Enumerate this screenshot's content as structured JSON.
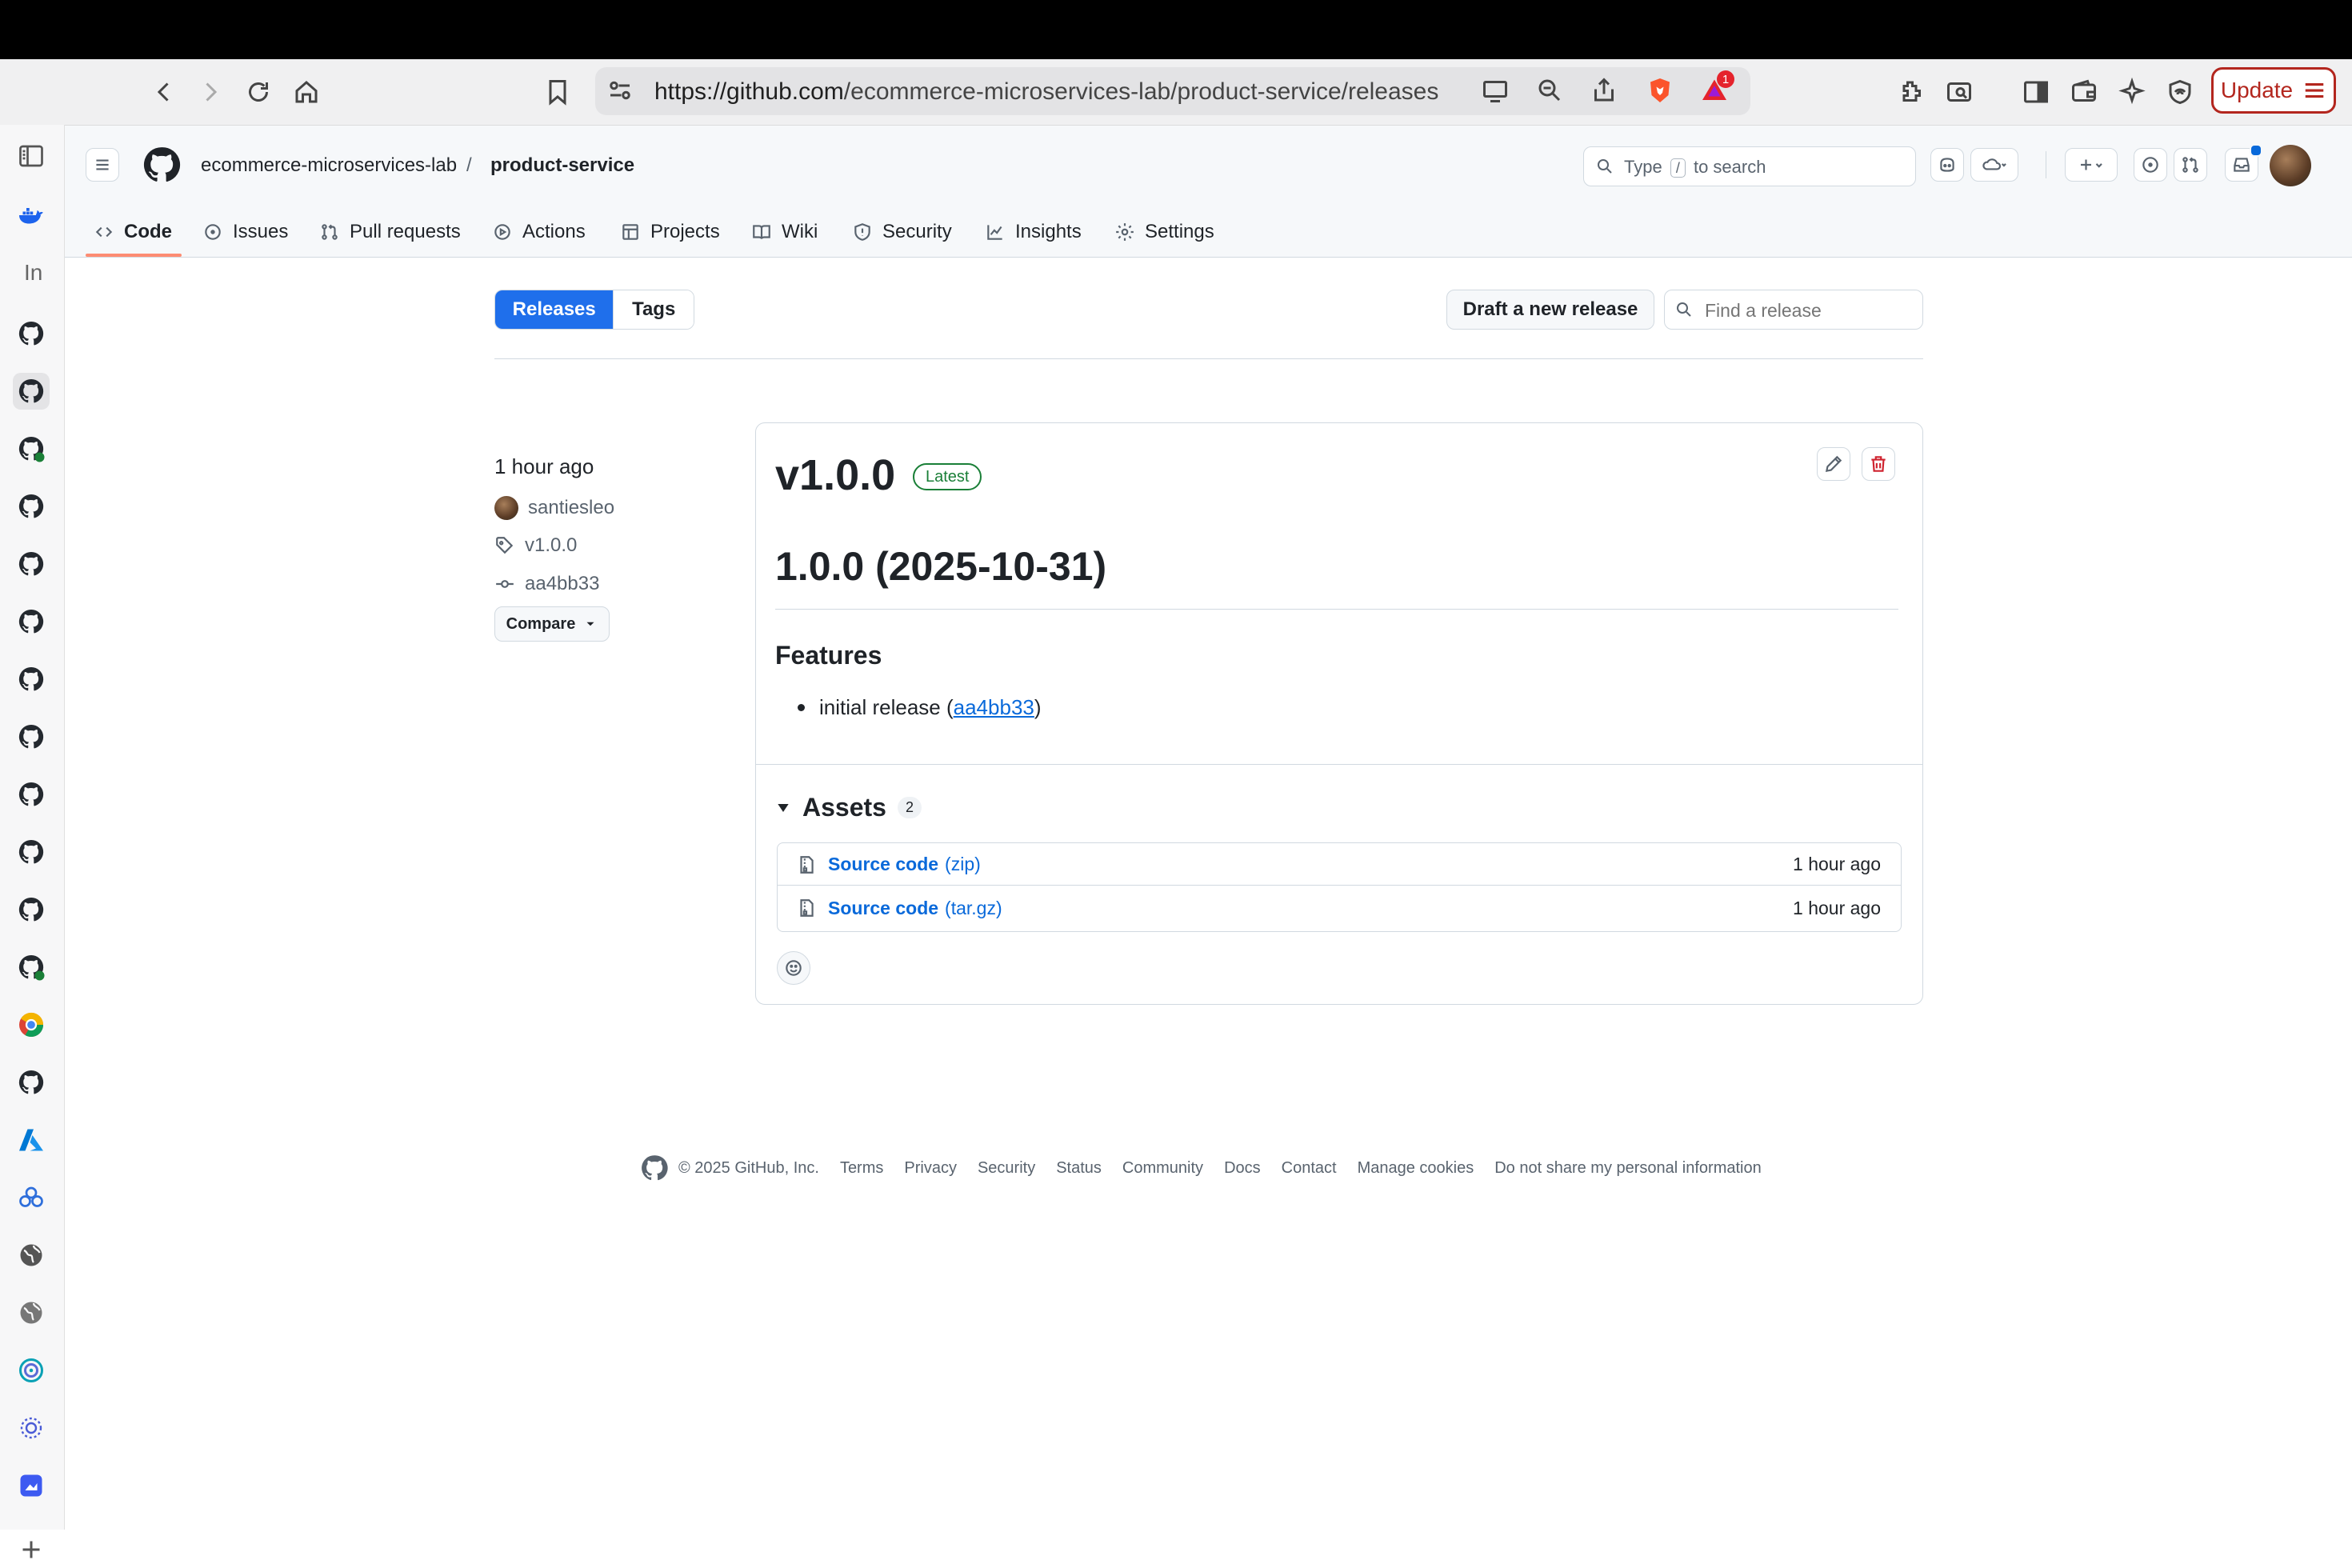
{
  "browser": {
    "url_host": "https://github.com",
    "url_path": "/ecommerce-microservices-lab/product-service/releases",
    "notification_badge": "1",
    "update_label": "Update"
  },
  "sidebar": {
    "partial_label": "In"
  },
  "header": {
    "owner": "ecommerce-microservices-lab",
    "separator": "/",
    "repo": "product-service",
    "search_prefix": "Type",
    "search_key": "/",
    "search_suffix": "to search"
  },
  "repo_tabs": [
    {
      "label": "Code"
    },
    {
      "label": "Issues"
    },
    {
      "label": "Pull requests"
    },
    {
      "label": "Actions"
    },
    {
      "label": "Projects"
    },
    {
      "label": "Wiki"
    },
    {
      "label": "Security"
    },
    {
      "label": "Insights"
    },
    {
      "label": "Settings"
    }
  ],
  "releases_nav": {
    "releases_label": "Releases",
    "tags_label": "Tags",
    "draft_label": "Draft a new release",
    "find_placeholder": "Find a release"
  },
  "release": {
    "time_ago": "1 hour ago",
    "author": "santiesleo",
    "tag": "v1.0.0",
    "commit": "aa4bb33",
    "compare_label": "Compare",
    "title": "v1.0.0",
    "latest_badge": "Latest",
    "notes_heading": "1.0.0 (2025-10-31)",
    "section_heading": "Features",
    "bullet_text": "initial release (",
    "bullet_link": "aa4bb33",
    "bullet_close": ")",
    "assets_label": "Assets",
    "assets_count": "2",
    "assets": [
      {
        "name": "Source code",
        "ext": "(zip)",
        "time": "1 hour ago"
      },
      {
        "name": "Source code",
        "ext": "(tar.gz)",
        "time": "1 hour ago"
      }
    ]
  },
  "footer": {
    "copyright": "© 2025 GitHub, Inc.",
    "links": [
      "Terms",
      "Privacy",
      "Security",
      "Status",
      "Community",
      "Docs",
      "Contact",
      "Manage cookies",
      "Do not share my personal information"
    ]
  },
  "colors": {
    "accent_blue": "#0969da",
    "primary_button": "#1f6feb",
    "latest_green": "#1a7f37",
    "danger_red": "#cf222e",
    "tab_underline": "#fd8c73"
  }
}
